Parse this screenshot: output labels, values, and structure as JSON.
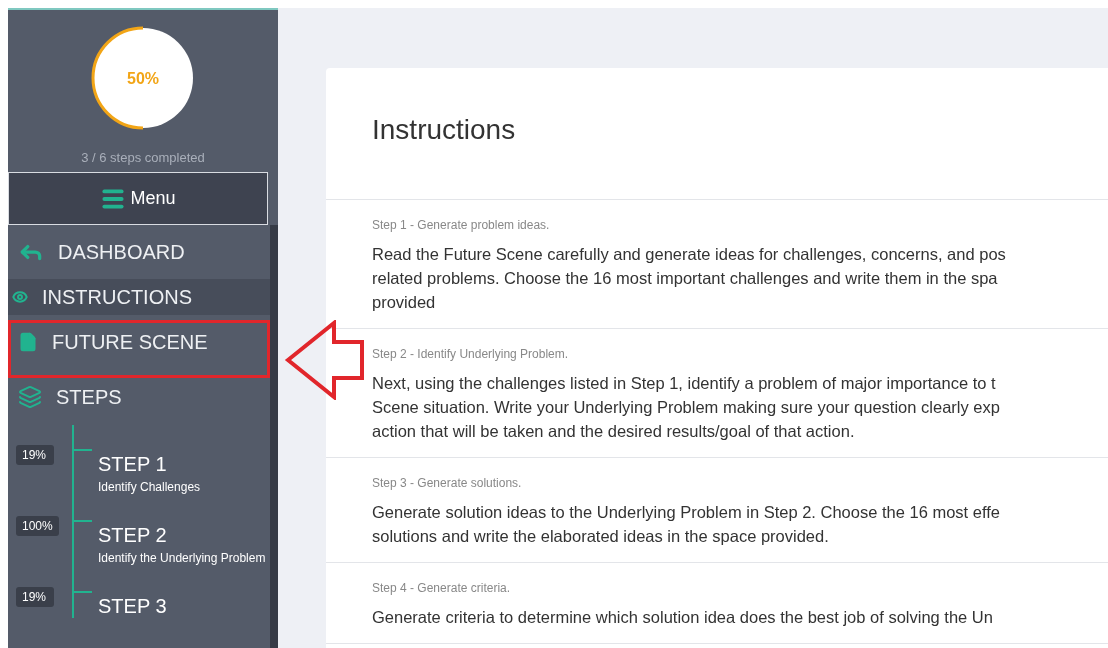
{
  "progress": {
    "level": 0.5,
    "label": "50%",
    "caption": "3 / 6 steps completed"
  },
  "menu_button": "Menu",
  "nav": [
    {
      "kind": "back",
      "label": "DASHBOARD",
      "selected": false
    },
    {
      "kind": "eye",
      "label": "INSTRUCTIONS",
      "selected": true
    },
    {
      "kind": "document",
      "label": "FUTURE SCENE",
      "selected": false
    },
    {
      "kind": "layers",
      "label": "STEPS",
      "selected": false
    }
  ],
  "steps": [
    {
      "badge": "19%",
      "title": "STEP 1",
      "subtitle": "Identify Challenges"
    },
    {
      "badge": "100%",
      "title": "STEP 2",
      "subtitle": "Identify the Underlying Problem"
    },
    {
      "badge": "19%",
      "title": "STEP 3"
    }
  ],
  "page": {
    "title": "Instructions",
    "sections": [
      {
        "heading": "Step 1 - Generate problem ideas.",
        "body": "Read the Future Scene carefully and generate ideas for challenges, concerns, and pos\nrelated problems. Choose the 16 most important challenges and write them in the spa\nprovided"
      },
      {
        "heading": "Step 2 - Identify Underlying Problem.",
        "body": "Next, using the challenges listed in Step 1, identify a problem of major importance to t\nScene situation. Write your Underlying Problem making sure your question clearly exp\naction that will be taken and the desired results/goal of that action."
      },
      {
        "heading": "Step 3 - Generate solutions.",
        "body": "Generate solution ideas to the Underlying Problem in Step 2. Choose the 16 most effe\nsolutions and write the elaborated ideas in the space provided."
      },
      {
        "heading": "Step 4 - Generate criteria.",
        "body": "Generate criteria to determine which solution idea does the best job of solving the Un"
      }
    ]
  }
}
